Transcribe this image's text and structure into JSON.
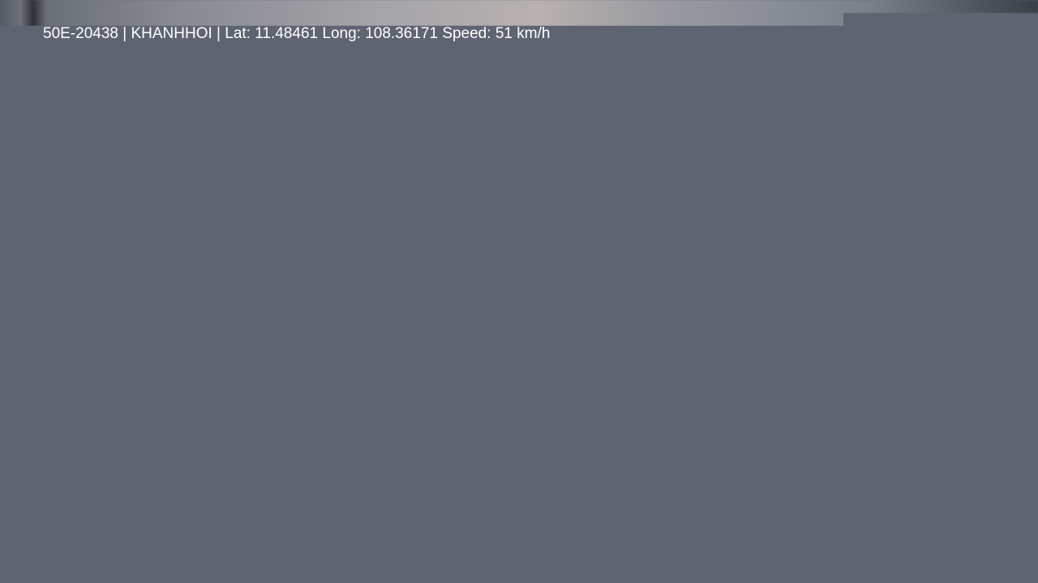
{
  "telemetry": {
    "vehicle_plate": "50E-20438",
    "separator_1": " | ",
    "company": "KHANHHOI",
    "separator_2": " | ",
    "lat_label": "Lat:",
    "lat_value": "11.48461",
    "long_label": "Long:",
    "long_value": "108.36171",
    "speed_label": "Speed:",
    "speed_value": "51",
    "speed_unit": "km/h"
  },
  "colors": {
    "overlay_background": "#5e6472",
    "telemetry_text": "#ffffff"
  }
}
